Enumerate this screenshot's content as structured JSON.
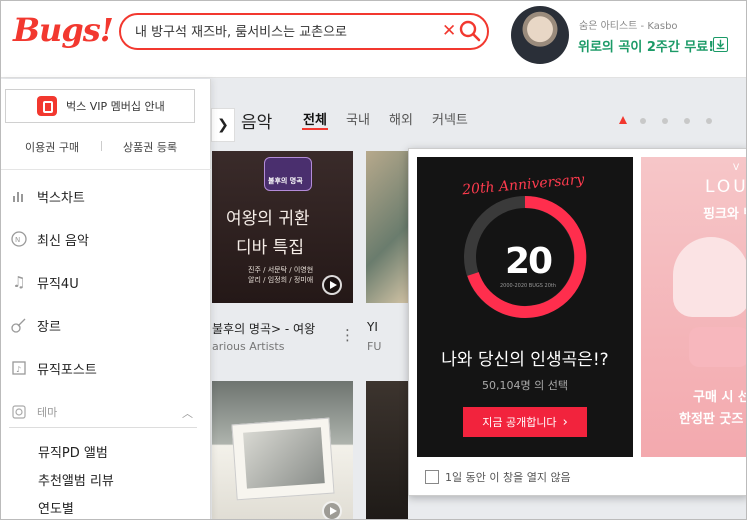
{
  "header": {
    "logo": "Bugs!",
    "search": {
      "value": "내 방구석 재즈바, 룸서비스는 교촌으로",
      "placeholder": ""
    },
    "artist_caption": "숨은 아티스트 - Kasbo",
    "promo_text": "위로의 곡이 2주간 무료!"
  },
  "menu": {
    "vip_label": "벅스 VIP 멤버십 안내",
    "links": [
      "이용권 구매",
      "상품권 등록"
    ],
    "items": [
      {
        "label": "벅스차트",
        "icon": "chart-icon"
      },
      {
        "label": "최신 음악",
        "icon": "new-music-icon"
      },
      {
        "label": "뮤직4U",
        "icon": "music-note-icon"
      },
      {
        "label": "장르",
        "icon": "guitar-icon"
      },
      {
        "label": "뮤직포스트",
        "icon": "music-post-icon"
      }
    ],
    "theme_label": "테마",
    "sub_items": [
      "뮤직PD 앨범",
      "추천앨범 리뷰",
      "연도별"
    ]
  },
  "content": {
    "section_title": "음악",
    "tabs": [
      {
        "label": "전체",
        "active": true
      },
      {
        "label": "국내",
        "active": false
      },
      {
        "label": "해외",
        "active": false
      },
      {
        "label": "커넥트",
        "active": false
      }
    ],
    "card1": {
      "badge": "불후의 명곡",
      "title_line1": "여왕의 귀환",
      "title_line2": "디바 특집",
      "names_line1": "진주 / 서문탁 / 이영현",
      "names_line2": "알리 / 임정희 / 정미애",
      "name": "불후의 명곡> - 여왕",
      "artist": "arious Artists"
    },
    "card2": {
      "name": "YI",
      "artist": "FU"
    }
  },
  "popup": {
    "banner1": {
      "anniversary": "20th Anniversary",
      "number": "20",
      "small": "2000-2020 BUGS 20th",
      "headline": "나와 당신의 인생곡은!?",
      "count": "50,104명 의 선택",
      "cta": "지금 공개합니다"
    },
    "banner2": {
      "brand": "V",
      "logo": "LOU",
      "text1": "핑크와 벤",
      "text2": "구매 시 선",
      "text3": "한정판 굿즈"
    },
    "checkbox_label": "1일 동안 이 창을 열지 않음"
  },
  "colors": {
    "brand": "#f2382f",
    "promo": "#1b9a67",
    "cta": "#f2233d"
  }
}
